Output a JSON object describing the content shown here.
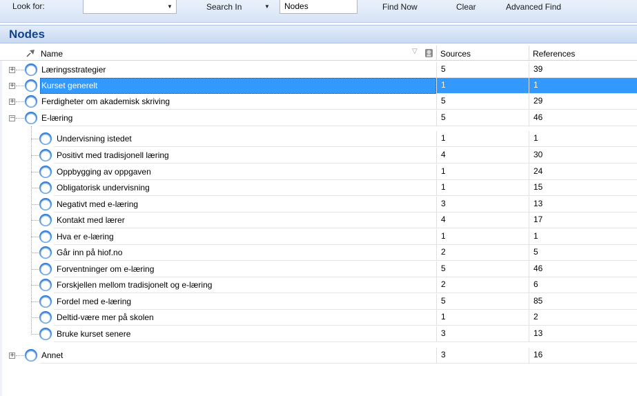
{
  "findbar": {
    "look_for_label": "Look for:",
    "look_for_value": "",
    "search_in_label": "Search In",
    "search_in_value": "Nodes",
    "find_now": "Find Now",
    "clear": "Clear",
    "advanced_find": "Advanced Find"
  },
  "view": {
    "title": "Nodes"
  },
  "columns": {
    "name": "Name",
    "sort_glyph": "▽",
    "sources": "Sources",
    "references": "References"
  },
  "nodes": [
    {
      "name": "Læringsstrategier",
      "sources": "5",
      "references": "39",
      "expander": "+"
    },
    {
      "name": "Kurset generelt",
      "sources": "1",
      "references": "1",
      "expander": "+",
      "selected": true
    },
    {
      "name": "Ferdigheter om akademisk skriving",
      "sources": "5",
      "references": "29",
      "expander": "+"
    },
    {
      "name": "E-læring",
      "sources": "5",
      "references": "46",
      "expander": "−"
    }
  ],
  "children": [
    {
      "name": "Undervisning istedet",
      "sources": "1",
      "references": "1"
    },
    {
      "name": "Positivt med tradisjonell læring",
      "sources": "4",
      "references": "30"
    },
    {
      "name": "Oppbygging av oppgaven",
      "sources": "1",
      "references": "24"
    },
    {
      "name": "Obligatorisk undervisning",
      "sources": "1",
      "references": "15"
    },
    {
      "name": "Negativt med e-læring",
      "sources": "3",
      "references": "13"
    },
    {
      "name": "Kontakt med lærer",
      "sources": "4",
      "references": "17"
    },
    {
      "name": "Hva er e-læring",
      "sources": "1",
      "references": "1"
    },
    {
      "name": "Går inn på hiof.no",
      "sources": "2",
      "references": "5"
    },
    {
      "name": "Forventninger om e-læring",
      "sources": "5",
      "references": "46"
    },
    {
      "name": "Forskjellen mellom tradisjonelt og e-læring",
      "sources": "2",
      "references": "6"
    },
    {
      "name": "Fordel med e-læring",
      "sources": "5",
      "references": "85"
    },
    {
      "name": "Deltid-være mer på skolen",
      "sources": "1",
      "references": "2"
    },
    {
      "name": "Bruke kurset senere",
      "sources": "3",
      "references": "13"
    }
  ],
  "last_node": {
    "name": "Annet",
    "sources": "3",
    "references": "16",
    "expander": "+"
  },
  "colors": {
    "selection": "#3399ff",
    "header_text": "#15428b",
    "node_icon": "#2b77d3"
  },
  "icons": {
    "pin": "pin-icon",
    "node": "node-circle-icon",
    "sources": "sources-icon"
  }
}
